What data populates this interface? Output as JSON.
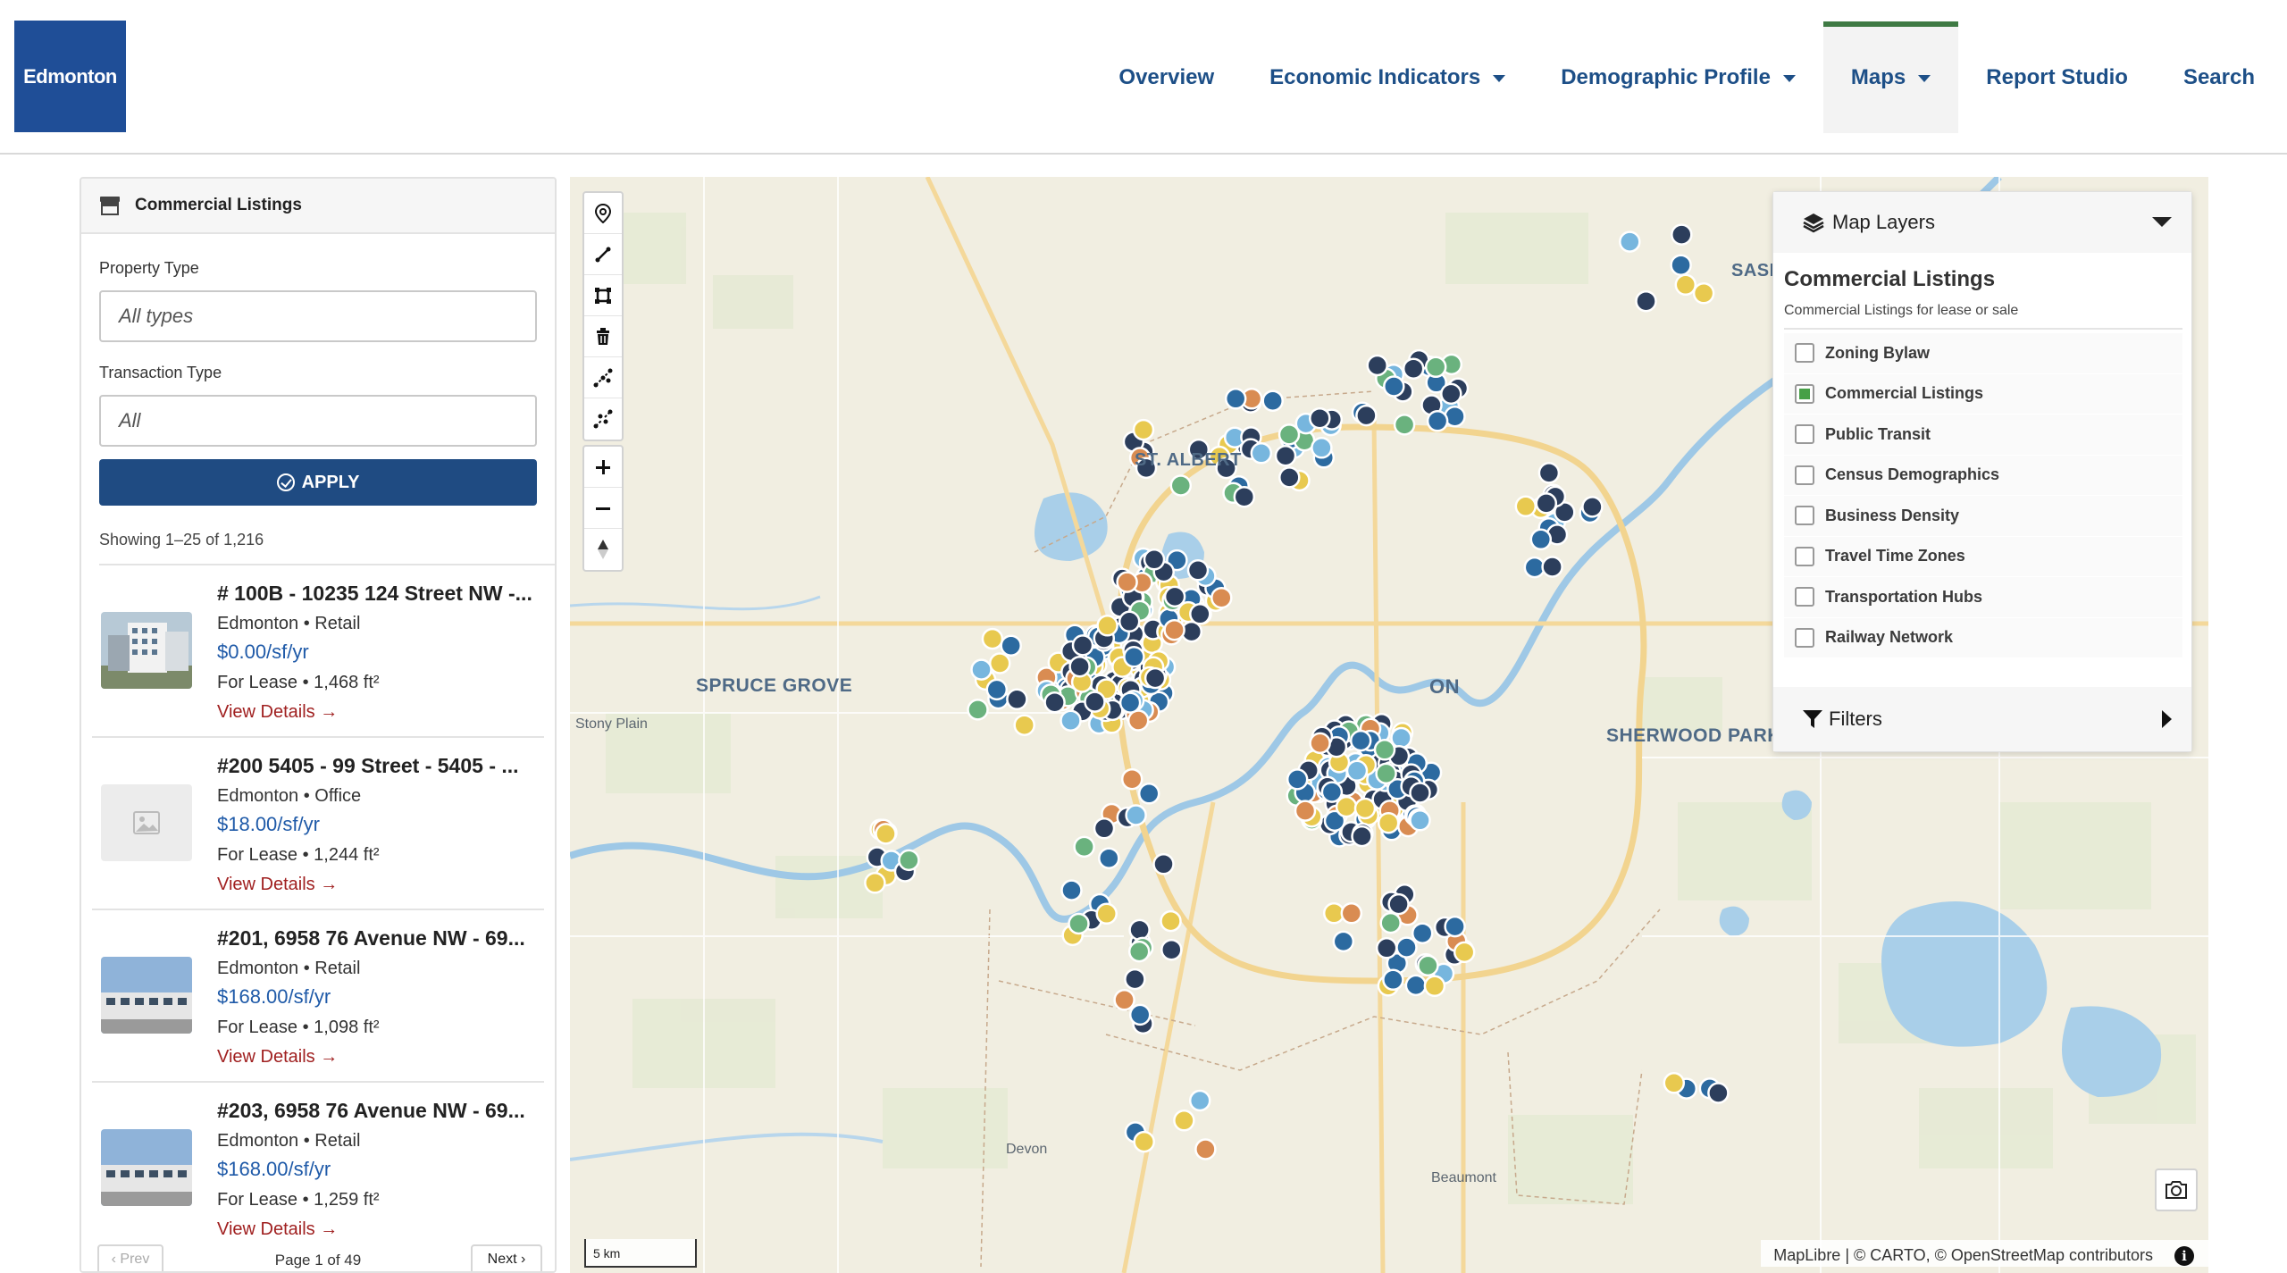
{
  "header": {
    "logo_text": "Edmonton",
    "nav": [
      {
        "label": "Overview",
        "dropdown": false,
        "active": false
      },
      {
        "label": "Economic Indicators",
        "dropdown": true,
        "active": false
      },
      {
        "label": "Demographic Profile",
        "dropdown": true,
        "active": false
      },
      {
        "label": "Maps",
        "dropdown": true,
        "active": true
      },
      {
        "label": "Report Studio",
        "dropdown": false,
        "active": false
      },
      {
        "label": "Search",
        "dropdown": false,
        "active": false
      }
    ]
  },
  "sidebar": {
    "title": "Commercial Listings",
    "title_icon": "store-icon",
    "property_type_label": "Property Type",
    "property_type_value": "All types",
    "transaction_type_label": "Transaction Type",
    "transaction_type_value": "All",
    "apply_label": "APPLY",
    "showing": "Showing 1–25 of 1,216",
    "listings": [
      {
        "title": "# 100B - 10235 124 Street NW -...",
        "location": "Edmonton • Retail",
        "price": "$0.00/sf/yr",
        "lease": "For Lease • 1,468 ft²",
        "link": "View Details →",
        "thumb": "building-photo"
      },
      {
        "title": "#200 5405 - 99 Street - 5405 - ...",
        "location": "Edmonton • Office",
        "price": "$18.00/sf/yr",
        "lease": "For Lease • 1,244 ft²",
        "link": "View Details →",
        "thumb": "image-placeholder-icon"
      },
      {
        "title": "#201, 6958 76 Avenue NW - 69...",
        "location": "Edmonton • Retail",
        "price": "$168.00/sf/yr",
        "lease": "For Lease • 1,098 ft²",
        "link": "View Details →",
        "thumb": "building-photo"
      },
      {
        "title": "#203, 6958 76 Avenue NW - 69...",
        "location": "Edmonton • Retail",
        "price": "$168.00/sf/yr",
        "lease": "For Lease • 1,259 ft²",
        "link": "View Details →",
        "thumb": "building-photo"
      }
    ],
    "pager": {
      "prev": "‹ Prev",
      "page_text": "Page 1 of 49",
      "next": "Next ›"
    }
  },
  "map": {
    "labels": {
      "st_albert": "ST. ALBERT",
      "spruce_grove": "SPRUCE GROVE",
      "stony_plain": "Stony Plain",
      "edmonton_partial": "ON",
      "sherwood_park": "SHERWOOD PARK",
      "sask_partial": "SASI",
      "devon": "Devon",
      "beaumont": "Beaumont"
    },
    "scale": "5 km",
    "attribution": "MapLibre | © CARTO, © OpenStreetMap contributors",
    "tools": [
      "marker-icon",
      "line-draw-icon",
      "polygon-draw-icon",
      "trash-icon",
      "combine-icon",
      "uncombine-icon"
    ],
    "zoom": [
      "zoom-in-icon",
      "zoom-out-icon",
      "compass-icon"
    ],
    "marker_colors": {
      "navy": "#2c3e5c",
      "blue": "#2c6aa0",
      "yellow": "#e8c94f",
      "orange": "#d98c52",
      "green": "#6ab27e",
      "lightblue": "#77b6de"
    }
  },
  "layers": {
    "header": "Map Layers",
    "section_title": "Commercial Listings",
    "section_desc": "Commercial Listings for lease or sale",
    "items": [
      {
        "label": "Zoning Bylaw",
        "checked": false
      },
      {
        "label": "Commercial Listings",
        "checked": true
      },
      {
        "label": "Public Transit",
        "checked": false
      },
      {
        "label": "Census Demographics",
        "checked": false
      },
      {
        "label": "Business Density",
        "checked": false
      },
      {
        "label": "Travel Time Zones",
        "checked": false
      },
      {
        "label": "Transportation Hubs",
        "checked": false
      },
      {
        "label": "Railway Network",
        "checked": false
      }
    ],
    "filters_label": "Filters"
  }
}
